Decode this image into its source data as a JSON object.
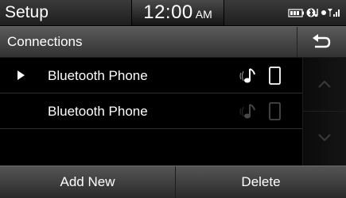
{
  "status_bar": {
    "title": "Setup",
    "time": "12:00",
    "ampm": "AM",
    "icons": [
      "battery-icon",
      "bluetooth-audio-icon",
      "signal-icon"
    ]
  },
  "header": {
    "title": "Connections",
    "back_icon": "back-arrow-icon"
  },
  "devices": [
    {
      "name": "Bluetooth Phone",
      "selected": true,
      "audio_icon": "music-note-icon",
      "phone_icon": "phone-icon"
    },
    {
      "name": "Bluetooth Phone",
      "selected": false,
      "audio_icon": "music-note-icon",
      "phone_icon": "phone-icon"
    }
  ],
  "scroll": {
    "up_icon": "chevron-up-icon",
    "down_icon": "chevron-down-icon"
  },
  "buttons": {
    "add_new": "Add New",
    "delete": "Delete"
  },
  "colors": {
    "background": "#000000",
    "bar_top": "#5a5a5a",
    "bar_bottom": "#323232",
    "text": "#ffffff"
  }
}
